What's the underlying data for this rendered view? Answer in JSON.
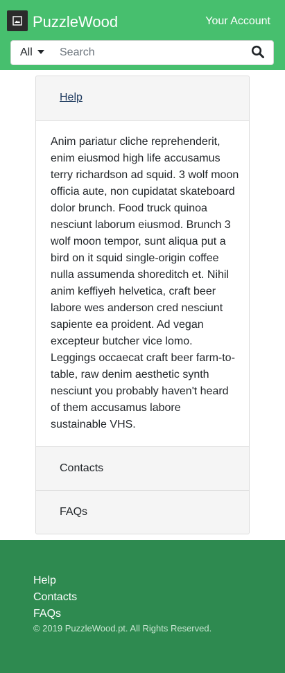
{
  "header": {
    "brand_name": "PuzzleWood",
    "account_label": "Your Account",
    "brand_color": "#47bf6e"
  },
  "search": {
    "category": "All",
    "placeholder": "Search",
    "value": ""
  },
  "accordion": {
    "help_label": "Help",
    "help_body": "Anim pariatur cliche reprehenderit, enim eiusmod high life accusamus terry richardson ad squid. 3 wolf moon officia aute, non cupidatat skateboard dolor brunch. Food truck quinoa nesciunt laborum eiusmod. Brunch 3 wolf moon tempor, sunt aliqua put a bird on it squid single-origin coffee nulla assumenda shoreditch et. Nihil anim keffiyeh helvetica, craft beer labore wes anderson cred nesciunt sapiente ea proident. Ad vegan excepteur butcher vice lomo. Leggings occaecat craft beer farm-to-table, raw denim aesthetic synth nesciunt you probably haven't heard of them accusamus labore sustainable VHS.",
    "contacts_label": "Contacts",
    "faqs_label": "FAQs"
  },
  "footer": {
    "links": [
      "Help",
      "Contacts",
      "FAQs"
    ],
    "copyright": "© 2019 PuzzleWood.pt. All Rights Reserved.",
    "footer_color": "#2e8a50"
  },
  "icons": {
    "logo": "image-icon",
    "search": "search-icon",
    "dropdown": "caret-down-icon"
  }
}
